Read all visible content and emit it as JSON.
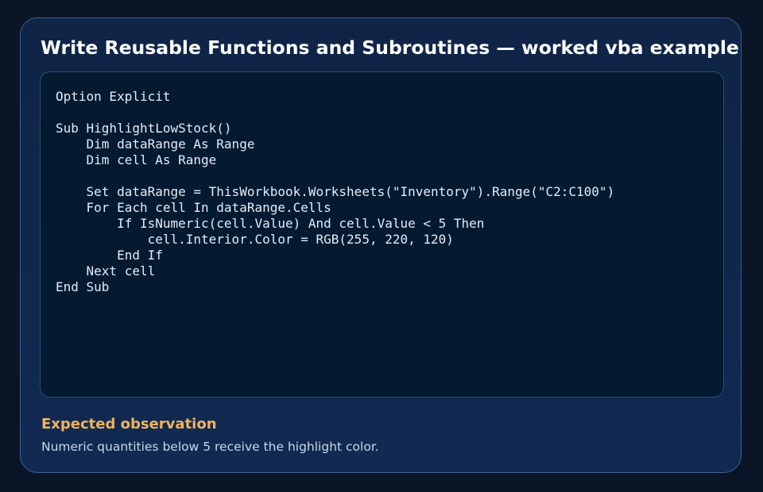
{
  "card": {
    "title": "Write Reusable Functions and Subroutines — worked vba example",
    "code": "Option Explicit\n\nSub HighlightLowStock()\n    Dim dataRange As Range\n    Dim cell As Range\n\n    Set dataRange = ThisWorkbook.Worksheets(\"Inventory\").Range(\"C2:C100\")\n    For Each cell In dataRange.Cells\n        If IsNumeric(cell.Value) And cell.Value < 5 Then\n            cell.Interior.Color = RGB(255, 220, 120)\n        End If\n    Next cell\nEnd Sub",
    "observation_heading": "Expected observation",
    "observation_text": "Numeric quantities below 5 receive the highlight color."
  },
  "colors": {
    "background": "#0a1628",
    "card": "#10264b",
    "code_panel": "#041a31",
    "title": "#ffffff",
    "code_text": "#e3ecf7",
    "observation_heading": "#f2b35a",
    "observation_text": "#c9d7ea"
  }
}
